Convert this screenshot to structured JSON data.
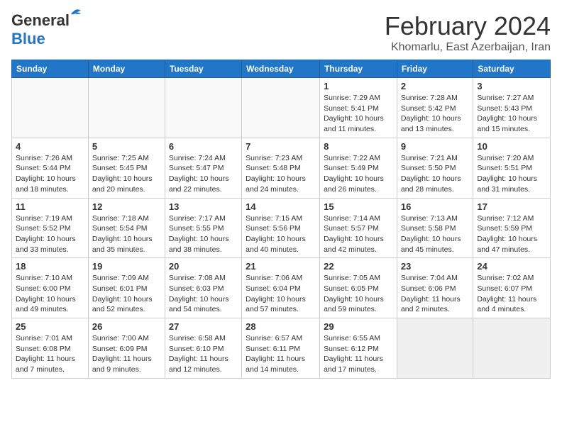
{
  "header": {
    "logo_general": "General",
    "logo_blue": "Blue",
    "month": "February 2024",
    "location": "Khomarlu, East Azerbaijan, Iran"
  },
  "weekdays": [
    "Sunday",
    "Monday",
    "Tuesday",
    "Wednesday",
    "Thursday",
    "Friday",
    "Saturday"
  ],
  "weeks": [
    [
      {
        "day": "",
        "info": ""
      },
      {
        "day": "",
        "info": ""
      },
      {
        "day": "",
        "info": ""
      },
      {
        "day": "",
        "info": ""
      },
      {
        "day": "1",
        "info": "Sunrise: 7:29 AM\nSunset: 5:41 PM\nDaylight: 10 hours\nand 11 minutes."
      },
      {
        "day": "2",
        "info": "Sunrise: 7:28 AM\nSunset: 5:42 PM\nDaylight: 10 hours\nand 13 minutes."
      },
      {
        "day": "3",
        "info": "Sunrise: 7:27 AM\nSunset: 5:43 PM\nDaylight: 10 hours\nand 15 minutes."
      }
    ],
    [
      {
        "day": "4",
        "info": "Sunrise: 7:26 AM\nSunset: 5:44 PM\nDaylight: 10 hours\nand 18 minutes."
      },
      {
        "day": "5",
        "info": "Sunrise: 7:25 AM\nSunset: 5:45 PM\nDaylight: 10 hours\nand 20 minutes."
      },
      {
        "day": "6",
        "info": "Sunrise: 7:24 AM\nSunset: 5:47 PM\nDaylight: 10 hours\nand 22 minutes."
      },
      {
        "day": "7",
        "info": "Sunrise: 7:23 AM\nSunset: 5:48 PM\nDaylight: 10 hours\nand 24 minutes."
      },
      {
        "day": "8",
        "info": "Sunrise: 7:22 AM\nSunset: 5:49 PM\nDaylight: 10 hours\nand 26 minutes."
      },
      {
        "day": "9",
        "info": "Sunrise: 7:21 AM\nSunset: 5:50 PM\nDaylight: 10 hours\nand 28 minutes."
      },
      {
        "day": "10",
        "info": "Sunrise: 7:20 AM\nSunset: 5:51 PM\nDaylight: 10 hours\nand 31 minutes."
      }
    ],
    [
      {
        "day": "11",
        "info": "Sunrise: 7:19 AM\nSunset: 5:52 PM\nDaylight: 10 hours\nand 33 minutes."
      },
      {
        "day": "12",
        "info": "Sunrise: 7:18 AM\nSunset: 5:54 PM\nDaylight: 10 hours\nand 35 minutes."
      },
      {
        "day": "13",
        "info": "Sunrise: 7:17 AM\nSunset: 5:55 PM\nDaylight: 10 hours\nand 38 minutes."
      },
      {
        "day": "14",
        "info": "Sunrise: 7:15 AM\nSunset: 5:56 PM\nDaylight: 10 hours\nand 40 minutes."
      },
      {
        "day": "15",
        "info": "Sunrise: 7:14 AM\nSunset: 5:57 PM\nDaylight: 10 hours\nand 42 minutes."
      },
      {
        "day": "16",
        "info": "Sunrise: 7:13 AM\nSunset: 5:58 PM\nDaylight: 10 hours\nand 45 minutes."
      },
      {
        "day": "17",
        "info": "Sunrise: 7:12 AM\nSunset: 5:59 PM\nDaylight: 10 hours\nand 47 minutes."
      }
    ],
    [
      {
        "day": "18",
        "info": "Sunrise: 7:10 AM\nSunset: 6:00 PM\nDaylight: 10 hours\nand 49 minutes."
      },
      {
        "day": "19",
        "info": "Sunrise: 7:09 AM\nSunset: 6:01 PM\nDaylight: 10 hours\nand 52 minutes."
      },
      {
        "day": "20",
        "info": "Sunrise: 7:08 AM\nSunset: 6:03 PM\nDaylight: 10 hours\nand 54 minutes."
      },
      {
        "day": "21",
        "info": "Sunrise: 7:06 AM\nSunset: 6:04 PM\nDaylight: 10 hours\nand 57 minutes."
      },
      {
        "day": "22",
        "info": "Sunrise: 7:05 AM\nSunset: 6:05 PM\nDaylight: 10 hours\nand 59 minutes."
      },
      {
        "day": "23",
        "info": "Sunrise: 7:04 AM\nSunset: 6:06 PM\nDaylight: 11 hours\nand 2 minutes."
      },
      {
        "day": "24",
        "info": "Sunrise: 7:02 AM\nSunset: 6:07 PM\nDaylight: 11 hours\nand 4 minutes."
      }
    ],
    [
      {
        "day": "25",
        "info": "Sunrise: 7:01 AM\nSunset: 6:08 PM\nDaylight: 11 hours\nand 7 minutes."
      },
      {
        "day": "26",
        "info": "Sunrise: 7:00 AM\nSunset: 6:09 PM\nDaylight: 11 hours\nand 9 minutes."
      },
      {
        "day": "27",
        "info": "Sunrise: 6:58 AM\nSunset: 6:10 PM\nDaylight: 11 hours\nand 12 minutes."
      },
      {
        "day": "28",
        "info": "Sunrise: 6:57 AM\nSunset: 6:11 PM\nDaylight: 11 hours\nand 14 minutes."
      },
      {
        "day": "29",
        "info": "Sunrise: 6:55 AM\nSunset: 6:12 PM\nDaylight: 11 hours\nand 17 minutes."
      },
      {
        "day": "",
        "info": ""
      },
      {
        "day": "",
        "info": ""
      }
    ]
  ]
}
